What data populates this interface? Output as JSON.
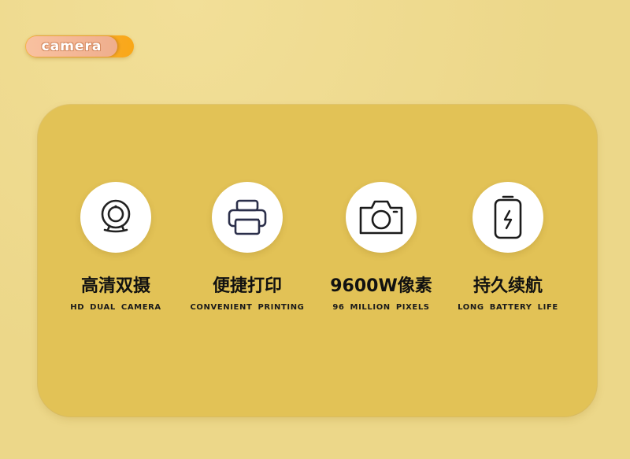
{
  "tag": {
    "label": "camera"
  },
  "features": [
    {
      "icon": "webcam-icon",
      "title": "高清双摄",
      "subtitle": "HD DUAL CAMERA"
    },
    {
      "icon": "printer-icon",
      "title": "便捷打印",
      "subtitle": "CONVENIENT PRINTING"
    },
    {
      "icon": "camera-icon",
      "title": "9600W像素",
      "subtitle": "96 MILLION PIXELS"
    },
    {
      "icon": "battery-icon",
      "title": "持久续航",
      "subtitle": "LONG BATTERY LIFE"
    }
  ],
  "colors": {
    "background": "#ecd789",
    "panel": "#e2c256",
    "tag_back": "#f9a718",
    "tag_front": "#efae8d",
    "icon_circle": "#ffffff",
    "text": "#111111"
  }
}
